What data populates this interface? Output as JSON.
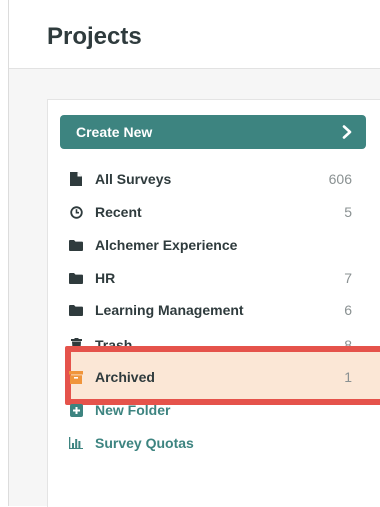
{
  "header": {
    "title": "Projects"
  },
  "sidebar": {
    "create_button": {
      "label": "Create New",
      "icon": "chevron-right-icon"
    },
    "items": [
      {
        "label": "All Surveys",
        "count": "606",
        "icon": "file-icon"
      },
      {
        "label": "Recent",
        "count": "5",
        "icon": "clock-icon"
      },
      {
        "label": "Alchemer Experience",
        "count": "",
        "icon": "folder-icon"
      },
      {
        "label": "HR",
        "count": "7",
        "icon": "folder-icon"
      },
      {
        "label": "Learning Management",
        "count": "6",
        "icon": "folder-icon"
      },
      {
        "label": "Trash",
        "count": "8",
        "icon": "trash-icon"
      },
      {
        "label": "Archived",
        "count": "1",
        "icon": "archive-box-icon"
      }
    ],
    "links": [
      {
        "label": "New Folder",
        "icon": "plus-square-icon"
      },
      {
        "label": "Survey Quotas",
        "icon": "bar-chart-icon"
      }
    ]
  },
  "colors": {
    "accent": "#3d8480",
    "text": "#2f3b3d",
    "count": "#8a9192",
    "highlight_border": "#e5534b",
    "highlight_fill": "#fbe7d6",
    "archive_icon": "#f0953b"
  }
}
